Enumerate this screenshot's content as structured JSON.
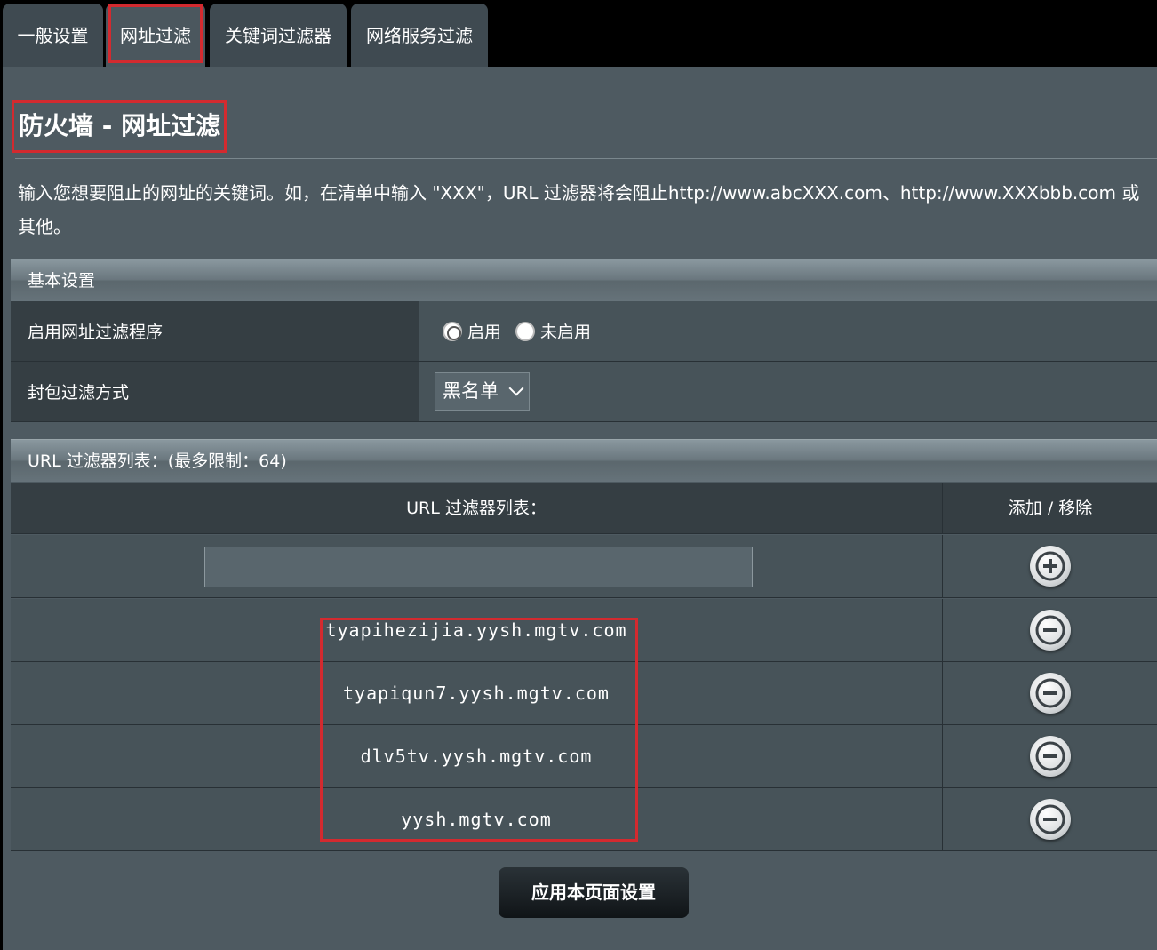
{
  "tabs": [
    {
      "label": "一般设置"
    },
    {
      "label": "网址过滤"
    },
    {
      "label": "关键词过滤器"
    },
    {
      "label": "网络服务过滤"
    }
  ],
  "page": {
    "title": "防火墙 - 网址过滤",
    "description": "输入您想要阻止的网址的关键词。如，在清单中输入 \"XXX\"，URL 过滤器将会阻止http://www.abcXXX.com、http://www.XXXbbb.com 或其他。"
  },
  "basic": {
    "header": "基本设置",
    "enable_label": "启用网址过滤程序",
    "enable_on": "启用",
    "enable_off": "未启用",
    "mode_label": "封包过滤方式",
    "mode_value": "黑名单"
  },
  "url_list": {
    "header": "URL 过滤器列表：(最多限制：64)",
    "col_url": "URL 过滤器列表：",
    "col_action": "添加 / 移除",
    "input_value": "",
    "entries": [
      "tyapihezijia.yysh.mgtv.com",
      "tyapiqun7.yysh.mgtv.com",
      "dlv5tv.yysh.mgtv.com",
      "yysh.mgtv.com"
    ]
  },
  "apply_label": "应用本页面设置",
  "colors": {
    "highlight": "#d32a2f",
    "panel": "#4e5a61"
  }
}
